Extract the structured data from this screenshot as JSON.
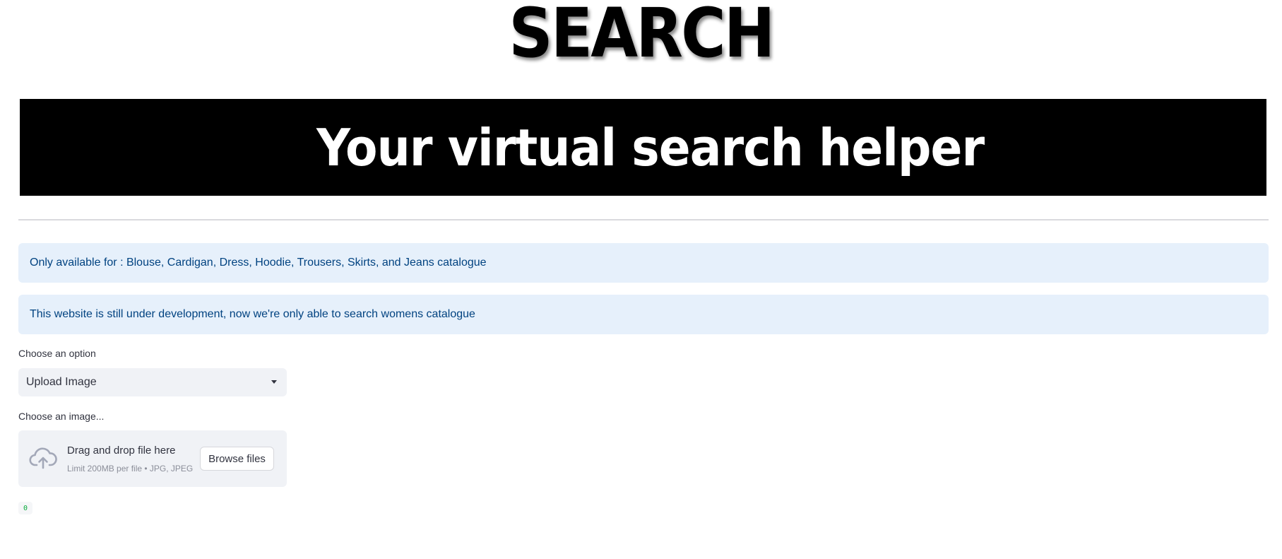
{
  "header": {
    "title": "SEARCH",
    "banner": "Your virtual search helper"
  },
  "info_messages": [
    "Only available for : Blouse, Cardigan, Dress, Hoodie, Trousers, Skirts, and Jeans catalogue",
    "This website is still under development, now we're only able to search womens catalogue"
  ],
  "option_select": {
    "label": "Choose an option",
    "selected": "Upload Image",
    "icon": "chevron-down-icon"
  },
  "uploader": {
    "label": "Choose an image...",
    "drop_text": "Drag and drop file here",
    "limit_text": "Limit 200MB per file • JPG, JPEG",
    "browse_label": "Browse files",
    "icon": "cloud-upload-icon"
  },
  "counter": {
    "value": "0"
  },
  "colors": {
    "info_bg": "#e6f0fb",
    "info_text": "#004280",
    "banner_bg": "#000000",
    "banner_text": "#ffffff",
    "counter_text": "#09ab3b"
  }
}
